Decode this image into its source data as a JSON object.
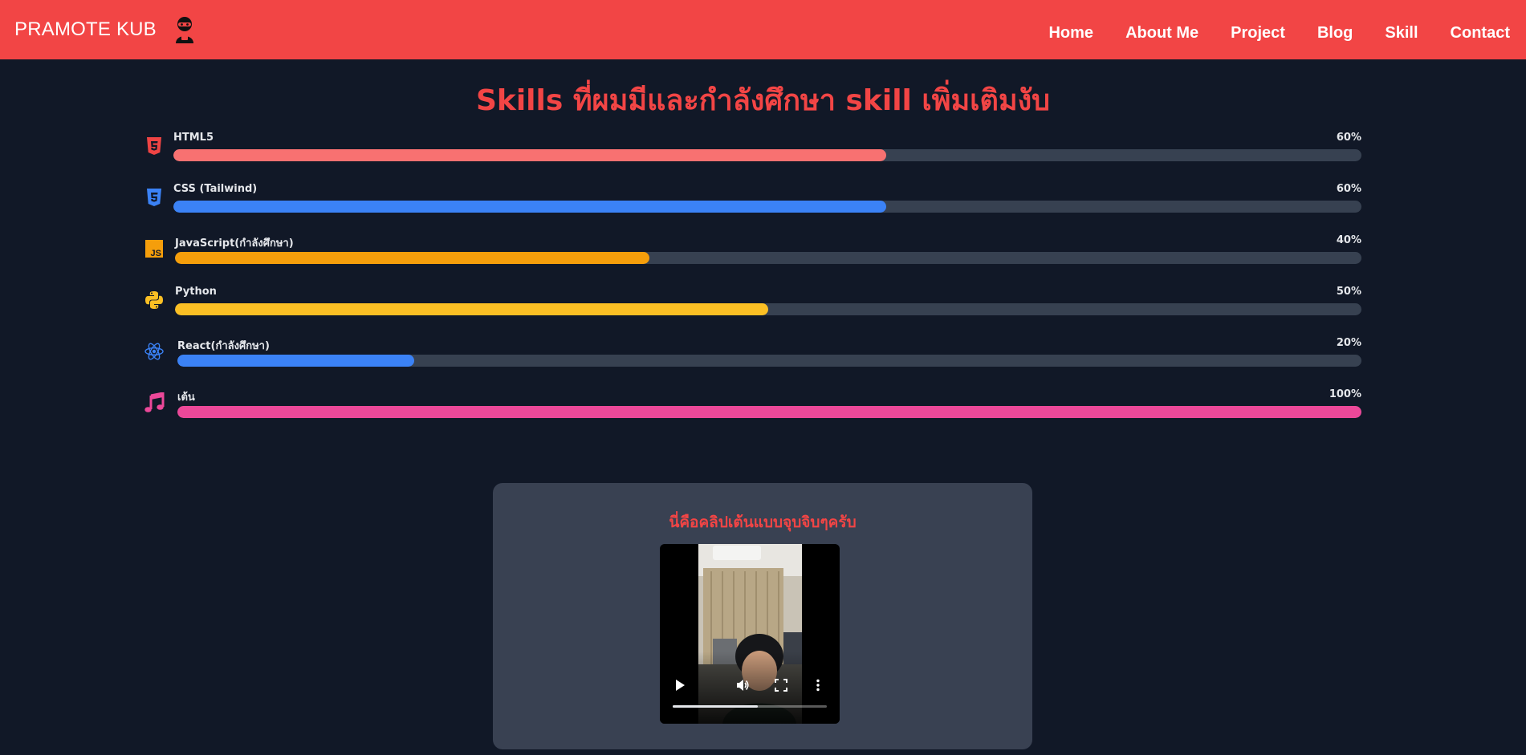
{
  "brand": {
    "name": "PRAMOTE KUB",
    "icon": "ninja-avatar-icon"
  },
  "nav": {
    "items": [
      {
        "label": "Home"
      },
      {
        "label": "About Me"
      },
      {
        "label": "Project"
      },
      {
        "label": "Blog"
      },
      {
        "label": "Skill"
      },
      {
        "label": "Contact"
      }
    ]
  },
  "skills_section": {
    "title": "Skills ที่ผมมีและกำลังศึกษา skill เพิ่มเติมงับ",
    "skills": [
      {
        "name": "HTML5",
        "percent_label": "60%",
        "percent": 60,
        "color": "#f87171",
        "icon": "html5-icon",
        "icon_color": "#ef4444"
      },
      {
        "name": "CSS (Tailwind)",
        "percent_label": "60%",
        "percent": 60,
        "color": "#3b82f6",
        "icon": "css3-icon",
        "icon_color": "#3b82f6"
      },
      {
        "name": "JavaScript(กำลังศึกษา)",
        "percent_label": "40%",
        "percent": 40,
        "color": "#f59e0b",
        "icon": "javascript-icon",
        "icon_color": "#f59e0b"
      },
      {
        "name": "Python",
        "percent_label": "50%",
        "percent": 50,
        "color": "#fbbf24",
        "icon": "python-icon",
        "icon_color": "#fbbf24"
      },
      {
        "name": "React(กำลังศึกษา)",
        "percent_label": "20%",
        "percent": 20,
        "color": "#3b82f6",
        "icon": "react-icon",
        "icon_color": "#3b82f6"
      },
      {
        "name": "เต้น",
        "percent_label": "100%",
        "percent": 100,
        "color": "#ec4899",
        "icon": "music-note-icon",
        "icon_color": "#ec4899"
      }
    ]
  },
  "video_card": {
    "caption": "นี่คือคลิปเต้นแบบจุบจิบๆครับ",
    "progress": 0.55
  }
}
